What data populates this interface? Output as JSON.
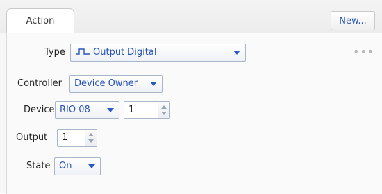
{
  "tabs": {
    "active_label": "Action"
  },
  "toolbar": {
    "new_label": "New..."
  },
  "form": {
    "type_label": "Type",
    "type_value": "Output Digital",
    "type_icon": "pulse-icon",
    "controller_label": "Controller",
    "controller_value": "Device Owner",
    "device_label": "Device",
    "device_value": "RIO 08",
    "device_index": "1",
    "output_label": "Output",
    "output_value": "1",
    "state_label": "State",
    "state_value": "On"
  },
  "overflow": {
    "icon": "more-icon",
    "text": "•••"
  },
  "colors": {
    "accent": "#2a55b8",
    "border": "#a9b6c9"
  }
}
